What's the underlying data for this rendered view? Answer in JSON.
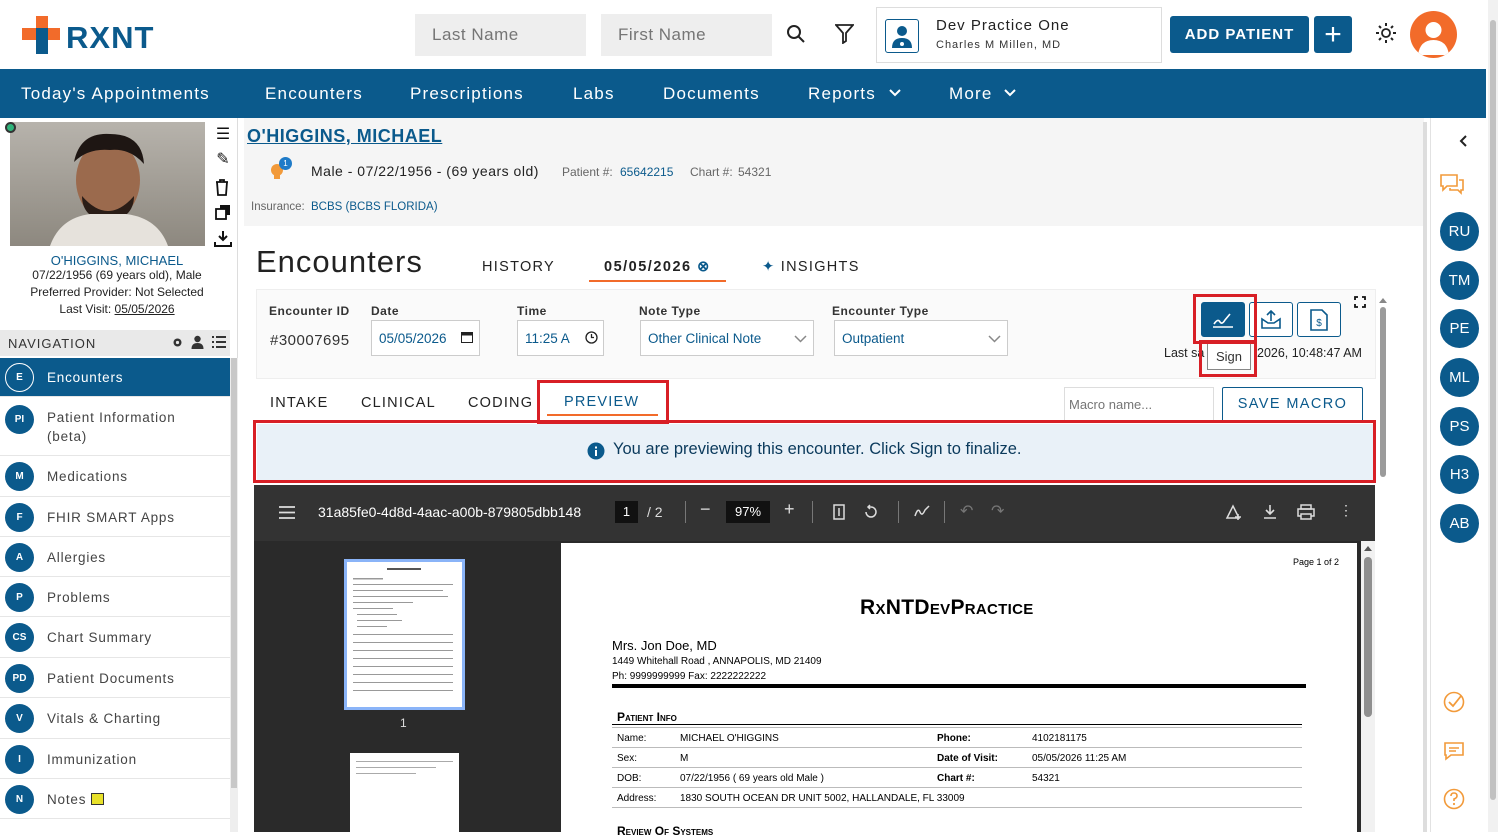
{
  "brand": {
    "name": "RXNT",
    "accent": "#0b5a8c",
    "orange": "#f29a3a",
    "red_highlight": "#d81f26"
  },
  "header": {
    "last_name_placeholder": "Last Name",
    "first_name_placeholder": "First Name",
    "practice_name": "Dev Practice One",
    "provider_name": "Charles M Millen, MD",
    "add_patient": "ADD PATIENT",
    "add_plus": "+"
  },
  "nav": {
    "items": [
      "Today's Appointments",
      "Encounters",
      "Prescriptions",
      "Labs",
      "Documents",
      "Reports",
      "More"
    ]
  },
  "patient_card": {
    "name": "O'HIGGINS, MICHAEL",
    "dob_line": "07/22/1956 (69 years old), Male",
    "provider_line": "Preferred Provider: Not Selected",
    "last_visit_label": "Last Visit:",
    "last_visit": "05/05/2026"
  },
  "sidebar": {
    "header": "NAVIGATION",
    "items": [
      {
        "badge": "E",
        "label": "Encounters"
      },
      {
        "badge": "PI",
        "label": "Patient Information (beta)"
      },
      {
        "badge": "M",
        "label": "Medications"
      },
      {
        "badge": "F",
        "label": "FHIR SMART Apps"
      },
      {
        "badge": "A",
        "label": "Allergies"
      },
      {
        "badge": "P",
        "label": "Problems"
      },
      {
        "badge": "CS",
        "label": "Chart Summary"
      },
      {
        "badge": "PD",
        "label": "Patient Documents"
      },
      {
        "badge": "V",
        "label": "Vitals & Charting"
      },
      {
        "badge": "I",
        "label": "Immunization"
      },
      {
        "badge": "N",
        "label": "Notes"
      }
    ]
  },
  "patient_header": {
    "name": "O'HIGGINS, MICHAEL",
    "alert_count": "1",
    "demographics": "Male - 07/22/1956 - (69 years old)",
    "patient_num_label": "Patient #:",
    "patient_num": "65642215",
    "chart_label": "Chart #:",
    "chart_num": "54321",
    "insurance_label": "Insurance:",
    "insurance": "BCBS (BCBS FLORIDA)"
  },
  "encounter": {
    "title": "Encounters",
    "tabs": {
      "history": "HISTORY",
      "date": "05/05/2026",
      "insights": "INSIGHTS"
    },
    "labels": {
      "id": "Encounter ID",
      "date": "Date",
      "time": "Time",
      "note_type": "Note Type",
      "enc_type": "Encounter Type"
    },
    "values": {
      "id": "#30007695",
      "date": "05/05/2026",
      "time": "11:25 A",
      "note_type": "Other Clinical Note",
      "enc_type": "Outpatient"
    },
    "last_saved_prefix": "Last sa",
    "last_saved_suffix": "2026, 10:48:47 AM",
    "sign_tooltip": "Sign",
    "subtabs": [
      "INTAKE",
      "CLINICAL",
      "CODING",
      "PREVIEW"
    ],
    "macro_placeholder": "Macro name...",
    "save_macro": "SAVE MACRO",
    "preview_notice": "You are previewing this encounter. Click Sign to finalize."
  },
  "pdf": {
    "filename": "31a85fe0-4d8d-4aac-a00b-879805dbb148",
    "current_page": "1",
    "total_pages": "/ 2",
    "zoom": "97%",
    "thumb_label": "1",
    "page_indicator": "Page 1 of 2",
    "practice": "RxNTDevPractice",
    "doctor": "Mrs. Jon Doe, MD",
    "address": "1449 Whitehall Road , ANNAPOLIS, MD 21409",
    "phone_fax": "Ph: 9999999999 Fax: 2222222222",
    "section_title": "Patient Info",
    "next_section": "Review Of Systems",
    "rows": [
      {
        "l1": "Name:",
        "v1": "MICHAEL O'HIGGINS",
        "l2": "Phone:",
        "v2": "4102181175"
      },
      {
        "l1": "Sex:",
        "v1": "M",
        "l2": "Date of Visit:",
        "v2": "05/05/2026 11:25 AM"
      },
      {
        "l1": "DOB:",
        "v1": "07/22/1956 ( 69 years old Male )",
        "l2": "Chart #:",
        "v2": "54321"
      },
      {
        "l1": "Address:",
        "v1": "1830 SOUTH OCEAN DR UNIT 5002, HALLANDALE, FL 33009",
        "l2": "",
        "v2": ""
      }
    ]
  },
  "right_rail": {
    "avatars": [
      "RU",
      "TM",
      "PE",
      "ML",
      "PS",
      "H3",
      "AB"
    ]
  }
}
